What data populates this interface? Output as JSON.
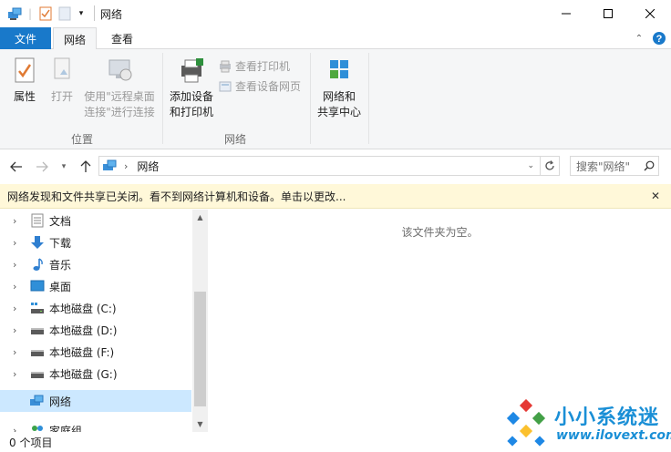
{
  "window": {
    "title": "网络",
    "controls": {
      "minimize": "minimize-icon",
      "maximize": "maximize-icon",
      "close": "close-icon"
    }
  },
  "ribbon": {
    "tabs": [
      {
        "label": "文件",
        "active": false,
        "accent": "#1979ca"
      },
      {
        "label": "网络",
        "active": true
      },
      {
        "label": "查看",
        "active": false
      }
    ],
    "groups": [
      {
        "label": "位置",
        "buttons": [
          {
            "label": "属性",
            "icon": "properties-icon",
            "enabled": true
          },
          {
            "label": "打开",
            "icon": "open-icon",
            "enabled": false
          },
          {
            "label": "使用\"远程桌面连接\"进行连接",
            "line1": "使用\"远程桌面",
            "line2": "连接\"进行连接",
            "icon": "remote-desktop-icon",
            "enabled": false
          }
        ]
      },
      {
        "label": "网络",
        "buttons": [
          {
            "label": "添加设备和打印机",
            "line1": "添加设备",
            "line2": "和打印机",
            "icon": "add-printer-icon",
            "enabled": true
          }
        ],
        "small_buttons": [
          {
            "label": "查看打印机",
            "icon": "printer-icon",
            "enabled": false
          },
          {
            "label": "查看设备网页",
            "icon": "device-webpage-icon",
            "enabled": false
          }
        ]
      },
      {
        "label": "",
        "buttons": [
          {
            "label": "网络和共享中心",
            "line1": "网络和",
            "line2": "共享中心",
            "icon": "network-sharing-icon",
            "enabled": true
          }
        ]
      }
    ]
  },
  "navigation": {
    "address": "网络",
    "search_placeholder": "搜索\"网络\""
  },
  "infobar": {
    "message": "网络发现和文件共享已关闭。看不到网络计算机和设备。单击以更改..."
  },
  "nav_pane": {
    "items": [
      {
        "label": "文档",
        "icon": "documents-icon"
      },
      {
        "label": "下载",
        "icon": "downloads-icon"
      },
      {
        "label": "音乐",
        "icon": "music-icon"
      },
      {
        "label": "桌面",
        "icon": "desktop-icon"
      },
      {
        "label": "本地磁盘 (C:)",
        "icon": "system-drive-icon"
      },
      {
        "label": "本地磁盘 (D:)",
        "icon": "drive-icon"
      },
      {
        "label": "本地磁盘 (F:)",
        "icon": "drive-icon"
      },
      {
        "label": "本地磁盘 (G:)",
        "icon": "drive-icon"
      },
      {
        "label": "网络",
        "icon": "network-icon",
        "selected": true
      },
      {
        "label": "家庭组",
        "icon": "homegroup-icon"
      }
    ]
  },
  "content": {
    "empty_message": "该文件夹为空。"
  },
  "status": {
    "item_count": "0 个项目"
  },
  "watermark": {
    "text": "小小系统迷",
    "url": "www.ilovext.com"
  }
}
